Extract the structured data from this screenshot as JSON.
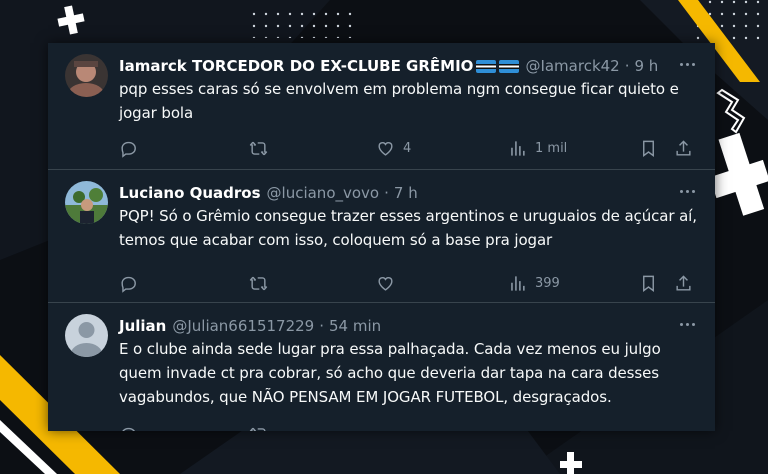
{
  "tweets": [
    {
      "name": "Iamarck TORCEDOR DO EX-CLUBE GRÊMIO",
      "handle": "@Iamarck42",
      "time": "9 h",
      "text": "pqp esses caras só se envolvem em problema ngm consegue ficar quieto e\njogar bola",
      "likes": "4",
      "views": "1 mil"
    },
    {
      "name": "Luciano Quadros",
      "handle": "@luciano_vovo",
      "time": "7 h",
      "text": "PQP! Só o Grêmio consegue trazer esses argentinos e uruguaios de açúcar aí,\ntemos que acabar com isso, coloquem só a base pra jogar",
      "views": "399"
    },
    {
      "name": "Julian",
      "handle": "@Julian661517229",
      "time": "54 min",
      "text": "E o clube ainda sede lugar pra essa palhaçada. Cada vez menos eu julgo\nquem invade ct pra cobrar, só acho que deveria dar tapa na cara desses\nvagabundos, que NÃO PENSAM EM JOGAR FUTEBOL, desgraçados."
    }
  ],
  "separator": "·",
  "colors": {
    "card_bg": "#15202b",
    "text": "#f7f9f9",
    "secondary": "#8b98a5",
    "accent_yellow": "#f5b800",
    "page_bg": "#0c0f14"
  },
  "icons": [
    "reply-icon",
    "retweet-icon",
    "like-icon",
    "views-icon",
    "bookmark-icon",
    "share-icon",
    "more-icon"
  ]
}
